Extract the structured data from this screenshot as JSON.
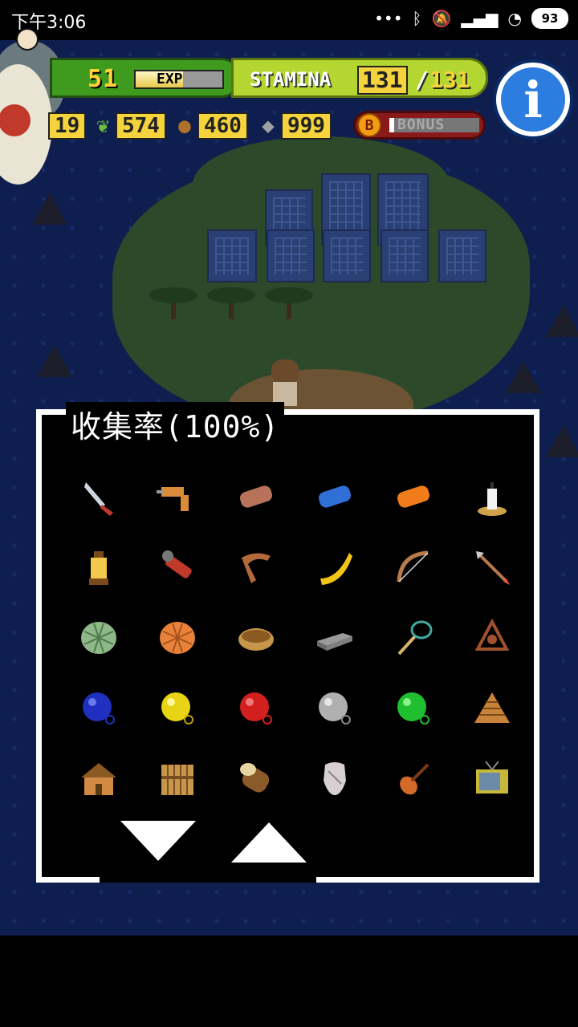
{
  "status_bar": {
    "time": "下午3:06",
    "battery": "93",
    "icons": [
      "more-dots-icon",
      "bluetooth-icon",
      "mute-icon",
      "signal-icon",
      "wifi-icon",
      "battery-icon"
    ]
  },
  "hud": {
    "level": "51",
    "exp_label": "EXP",
    "exp_fill": 0.55,
    "stamina_label": "STAMINA",
    "stamina_current": "131",
    "stamina_separator": "/",
    "stamina_max": "131",
    "resources": [
      {
        "icon": "coin-icon",
        "value": "19"
      },
      {
        "icon": "leaf-icon",
        "value": "574"
      },
      {
        "icon": "acorn-icon",
        "value": "460"
      },
      {
        "icon": "stone-icon",
        "value": "999"
      }
    ],
    "bonus_badge": "B",
    "bonus_label": "BONUS",
    "bonus_fill": 0.05,
    "info_label": "i"
  },
  "collection": {
    "title": "收集率(100%)",
    "items": [
      {
        "name": "machete-icon"
      },
      {
        "name": "drill-icon"
      },
      {
        "name": "wood-log-icon"
      },
      {
        "name": "blue-log-icon"
      },
      {
        "name": "orange-log-icon"
      },
      {
        "name": "candle-icon"
      },
      {
        "name": "lantern-icon"
      },
      {
        "name": "flashlight-icon"
      },
      {
        "name": "boomerang-brown-icon"
      },
      {
        "name": "boomerang-yellow-icon"
      },
      {
        "name": "bow-icon"
      },
      {
        "name": "arrow-icon"
      },
      {
        "name": "green-net-icon"
      },
      {
        "name": "orange-net-icon"
      },
      {
        "name": "basket-icon"
      },
      {
        "name": "stone-block-icon"
      },
      {
        "name": "fishing-net-icon"
      },
      {
        "name": "sextant-icon"
      },
      {
        "name": "blue-float-icon"
      },
      {
        "name": "yellow-float-icon"
      },
      {
        "name": "red-float-icon"
      },
      {
        "name": "gray-float-icon"
      },
      {
        "name": "green-float-icon"
      },
      {
        "name": "log-pile-icon"
      },
      {
        "name": "house-icon"
      },
      {
        "name": "wooden-fence-icon"
      },
      {
        "name": "log-stump-icon"
      },
      {
        "name": "tooth-icon"
      },
      {
        "name": "violin-icon"
      },
      {
        "name": "television-icon"
      }
    ]
  },
  "colors": {
    "panel_border": "#ffffff",
    "stamina_green": "#b3d631",
    "level_green": "#3f9b1e",
    "value_yellow": "#f4d33c",
    "bonus_red": "#8a1919",
    "info_blue": "#2d7de0"
  }
}
